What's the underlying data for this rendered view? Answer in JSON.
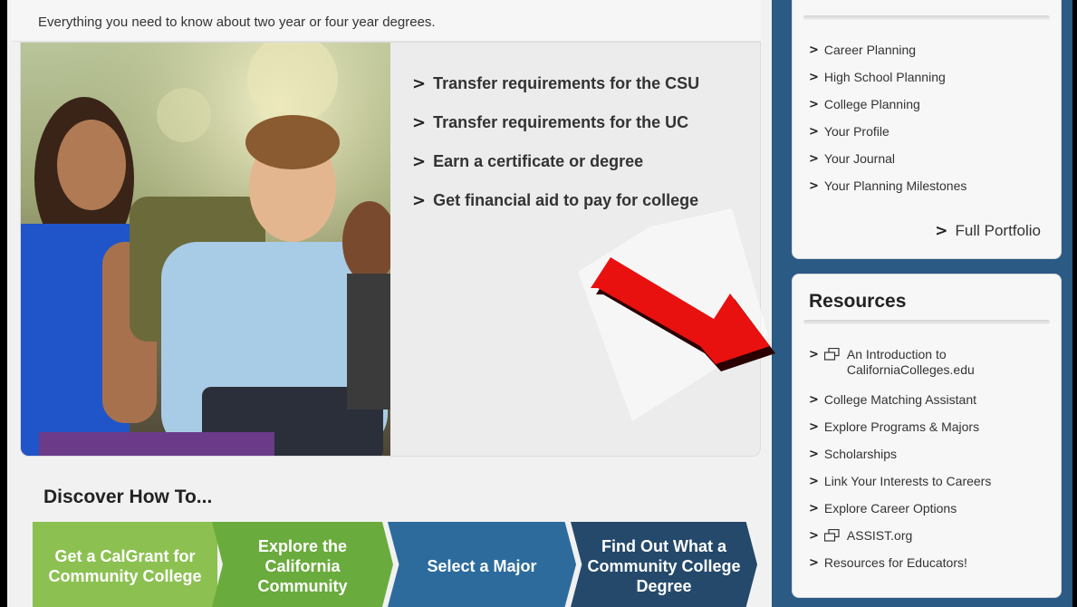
{
  "hero": {
    "subtitle": "Everything you need to know about two year or four year degrees.",
    "links": [
      "Transfer requirements for the CSU",
      "Transfer requirements for the UC",
      "Earn a certificate or degree",
      "Get financial aid to pay for college"
    ]
  },
  "discover": {
    "title": "Discover How To...",
    "steps": [
      {
        "label": "Get a CalGrant for Community College",
        "color": "#8cc152"
      },
      {
        "label": "Explore the California Community",
        "color": "#6aab3d"
      },
      {
        "label": "Select a Major",
        "color": "#2c6b9c"
      },
      {
        "label": "Find Out What a Community College Degree",
        "color": "#24496b"
      }
    ]
  },
  "portfolio": {
    "items": [
      "Career Planning",
      "High School Planning",
      "College Planning",
      "Your Profile",
      "Your Journal",
      "Your Planning Milestones"
    ],
    "full_link": "Full Portfolio"
  },
  "resources": {
    "title": "Resources",
    "items": [
      {
        "label": "An Introduction to CaliforniaColleges.edu",
        "external": true
      },
      {
        "label": "College Matching Assistant",
        "external": false
      },
      {
        "label": "Explore Programs & Majors",
        "external": false
      },
      {
        "label": "Scholarships",
        "external": false
      },
      {
        "label": "Link Your Interests to Careers",
        "external": false
      },
      {
        "label": "Explore Career Options",
        "external": false
      },
      {
        "label": "ASSIST.org",
        "external": true
      },
      {
        "label": "Resources for Educators!",
        "external": false
      }
    ]
  },
  "icons": {
    "chevron": "chevron-right-icon",
    "external": "external-window-icon",
    "annotation": "red-arrow-annotation-icon"
  },
  "colors": {
    "sidebar": "#2b5a85",
    "arrow": "#e8110f"
  }
}
